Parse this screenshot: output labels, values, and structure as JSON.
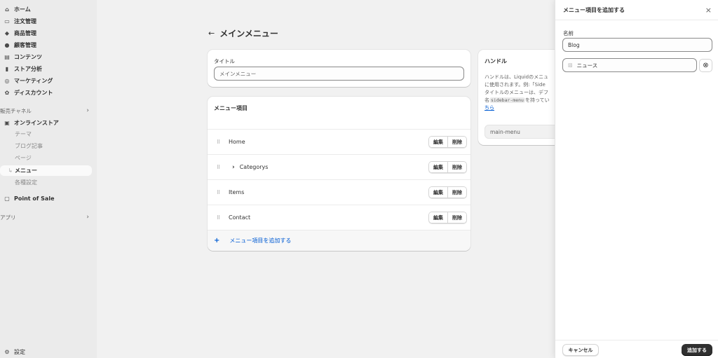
{
  "sidebar": {
    "items": [
      {
        "icon": "home-icon",
        "glyph": "⌂",
        "label": "ホーム"
      },
      {
        "icon": "inbox-icon",
        "glyph": "▭",
        "label": "注文管理"
      },
      {
        "icon": "tag-icon",
        "glyph": "◆",
        "label": "商品管理"
      },
      {
        "icon": "person-icon",
        "glyph": "●",
        "label": "顧客管理"
      },
      {
        "icon": "content-icon",
        "glyph": "▤",
        "label": "コンテンツ"
      },
      {
        "icon": "bar-chart-icon",
        "glyph": "▮",
        "label": "ストア分析"
      },
      {
        "icon": "target-icon",
        "glyph": "◎",
        "label": "マーケティング"
      },
      {
        "icon": "discount-icon",
        "glyph": "✿",
        "label": "ディスカウント"
      }
    ],
    "sales_channels_label": "販売チャネル",
    "online_store": {
      "icon": "store-icon",
      "glyph": "▣",
      "label": "オンラインストア"
    },
    "sub_items": [
      "テーマ",
      "ブログ記事",
      "ページ",
      "メニュー",
      "各種設定"
    ],
    "pos": {
      "icon": "pos-icon",
      "glyph": "▢",
      "label": "Point of Sale"
    },
    "apps_label": "アプリ",
    "settings": {
      "icon": "gear-icon",
      "glyph": "⚙",
      "label": "設定"
    }
  },
  "main": {
    "back_glyph": "←",
    "title": "メインメニュー",
    "title_card": {
      "label": "タイトル",
      "value": "メインメニュー"
    },
    "menu_card": {
      "heading": "メニュー項目",
      "items": [
        {
          "name": "Home",
          "expandable": false
        },
        {
          "name": "Categorys",
          "expandable": true
        },
        {
          "name": "Items",
          "expandable": false
        },
        {
          "name": "Contact",
          "expandable": false
        }
      ],
      "edit_label": "編集",
      "delete_label": "削除",
      "add_label": "メニュー項目を追加する"
    },
    "handle_card": {
      "heading": "ハンドル",
      "desc_line1": "ハンドルは、Liquidのメニュ",
      "desc_line2": "に使用されます。例:「Side",
      "desc_line3": "タイトルのメニューは、デフ",
      "desc_line4_pre": "名",
      "desc_code": "sidebar-menu",
      "desc_line4_post": "を持ってい",
      "desc_link": "ちら",
      "handle_value": "main-menu"
    }
  },
  "panel": {
    "title": "メニュー項目を追加する",
    "name_label": "名前",
    "name_value": "Blog",
    "link_value": "ニュース",
    "cancel_label": "キャンセル",
    "add_label": "追加する"
  }
}
